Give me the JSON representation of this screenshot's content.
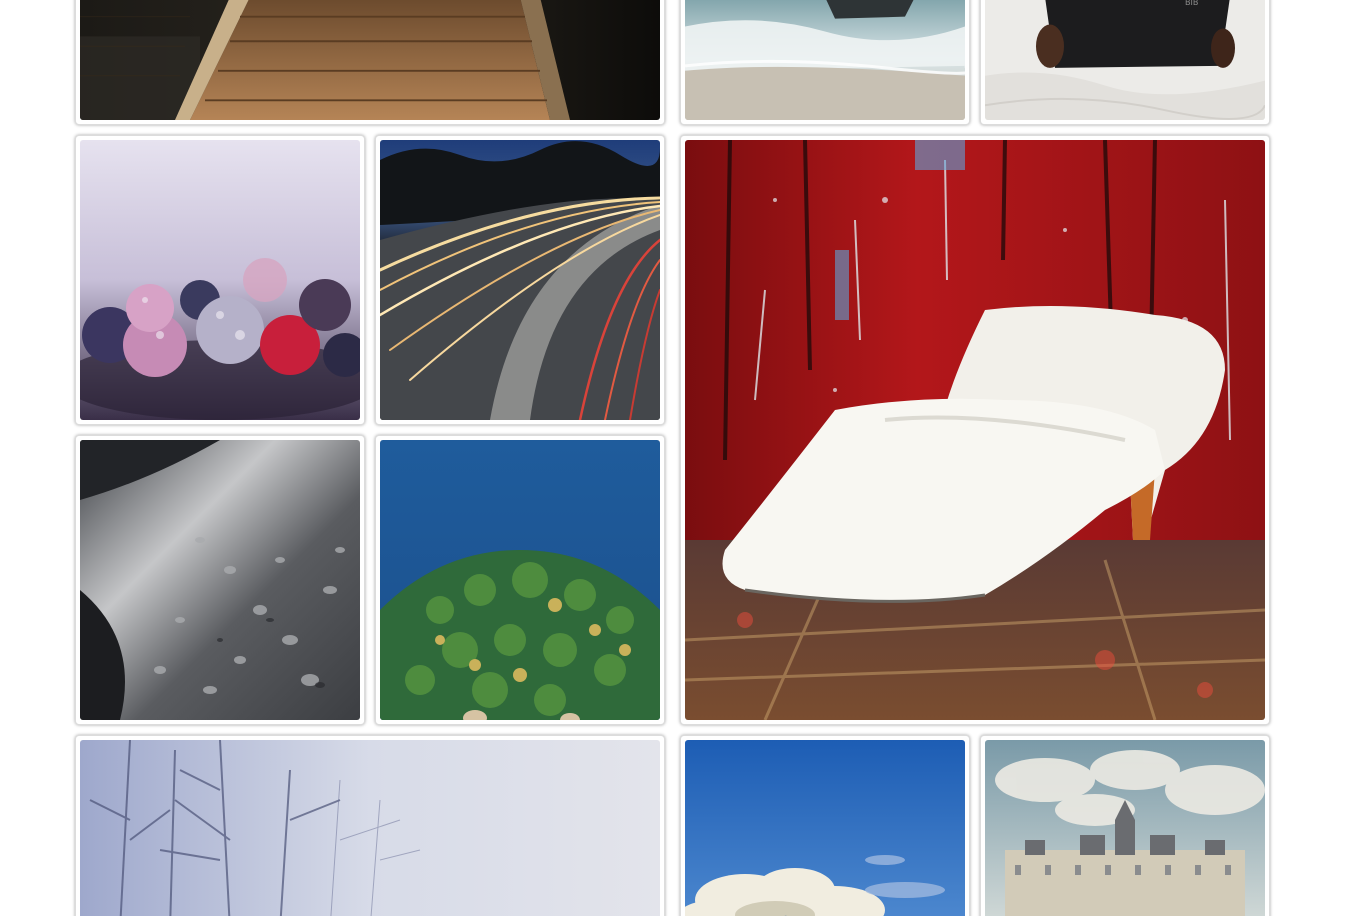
{
  "gallery": {
    "photos": [
      {
        "id": "escalator",
        "icon": "escalator-photo"
      },
      {
        "id": "waves",
        "icon": "ocean-waves-photo"
      },
      {
        "id": "bible",
        "icon": "person-reading-book-photo"
      },
      {
        "id": "berries",
        "icon": "frozen-berries-photo"
      },
      {
        "id": "lights",
        "icon": "highway-light-trails-photo"
      },
      {
        "id": "shoes",
        "icon": "white-high-heels-photo"
      },
      {
        "id": "drops",
        "icon": "water-droplets-photo"
      },
      {
        "id": "forest",
        "icon": "aerial-forest-lake-photo"
      },
      {
        "id": "trees",
        "icon": "winter-trees-photo"
      },
      {
        "id": "sky",
        "icon": "blue-sky-clouds-photo"
      },
      {
        "id": "castle",
        "icon": "chateau-castle-photo"
      }
    ]
  },
  "colors": {
    "tile_border": "#dcdcdc",
    "background": "#ffffff"
  }
}
